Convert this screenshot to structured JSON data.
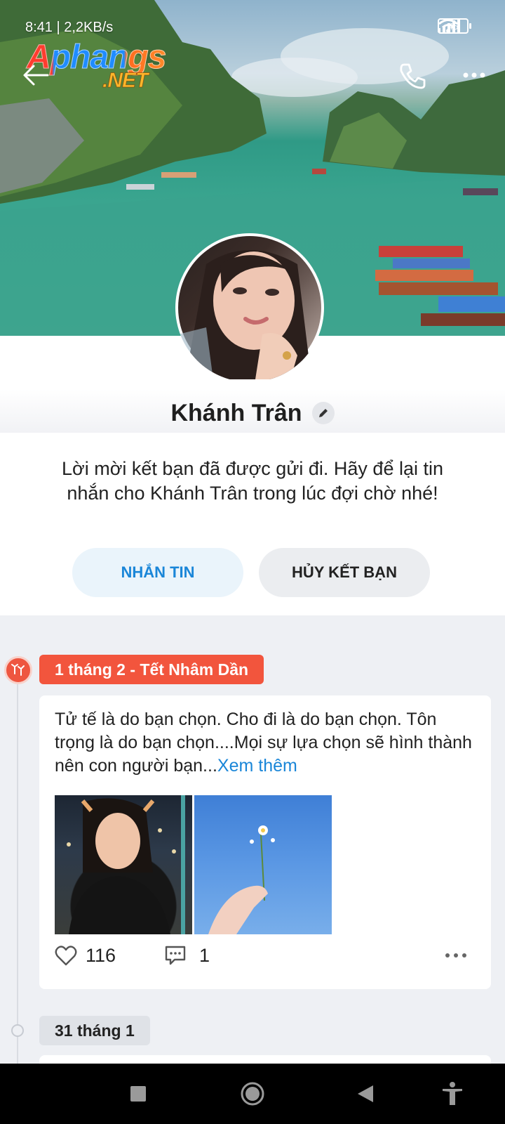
{
  "status_bar": {
    "time": "8:41 | 2,2KB/s",
    "battery": "45"
  },
  "watermark": {
    "line1": "Aphangs",
    "line2": ".NET"
  },
  "header": {
    "back_icon": "arrow-left-icon",
    "call_icon": "phone-icon",
    "more_icon": "more-horizontal-icon"
  },
  "profile": {
    "name": "Khánh Trân"
  },
  "invite": {
    "message": "Lời mời kết bạn đã được gửi đi. Hãy để lại tin nhắn cho Khánh Trân trong lúc đợi chờ nhé!",
    "message_button": "NHẮN TIN",
    "cancel_button": "HỦY KẾT BẠN"
  },
  "timeline": {
    "event_label": "1 tháng 2 - Tết Nhâm Dần",
    "post": {
      "text": "Tử tế là do bạn chọn. Cho đi là do bạn chọn. Tôn trọng là do bạn chọn....Mọi sự lựa chọn sẽ hình thành nên con người bạn...",
      "see_more": "Xem thêm",
      "likes": "116",
      "comments": "1"
    },
    "next_date": "31 tháng 1"
  },
  "colors": {
    "accent_blue": "#1a86d8",
    "event_red": "#f2553d",
    "background": "#eef0f4"
  }
}
